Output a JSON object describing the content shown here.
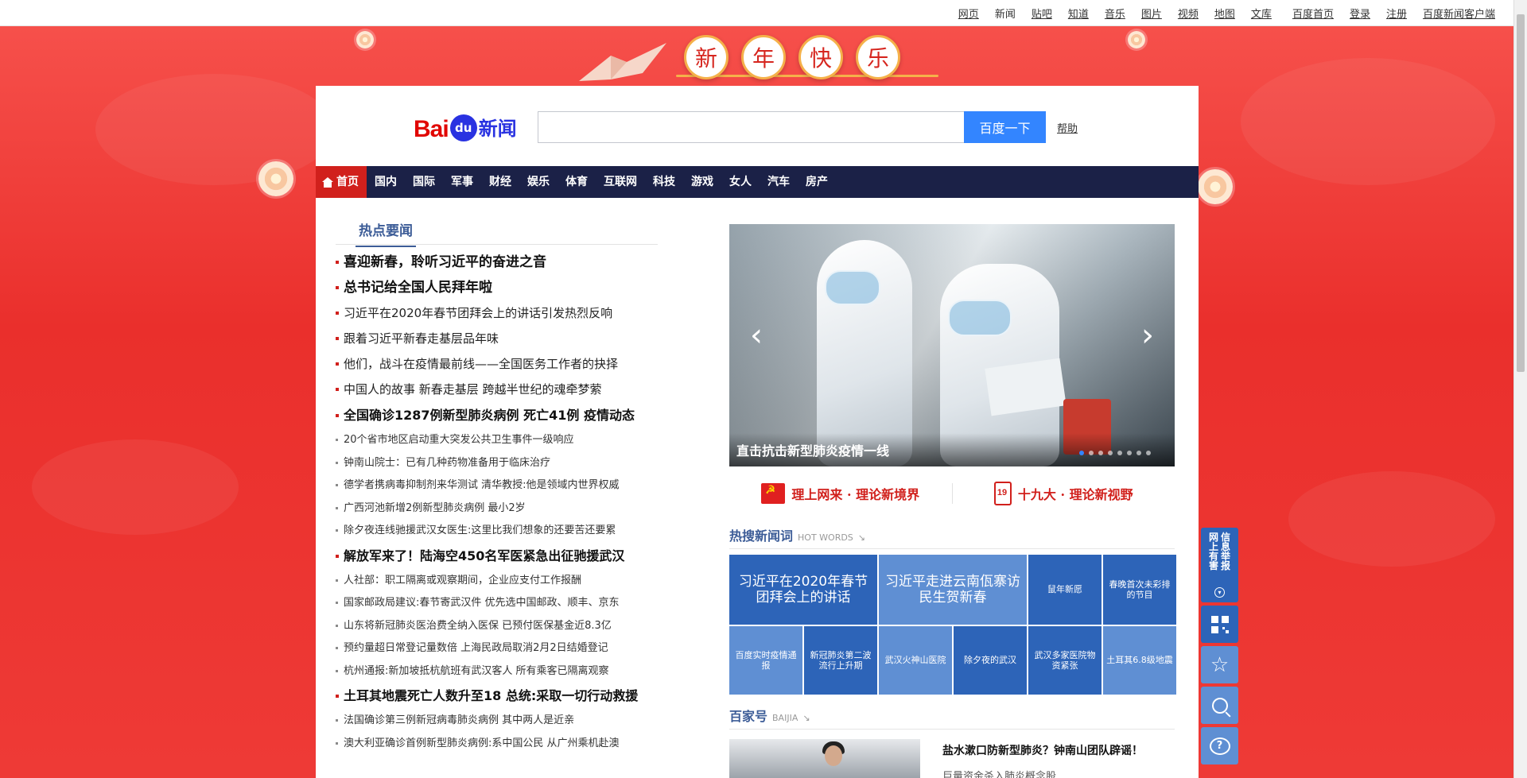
{
  "toplinks": {
    "items": [
      "网页",
      "新闻",
      "贴吧",
      "知道",
      "音乐",
      "图片",
      "视频",
      "地图",
      "文库"
    ],
    "right": [
      "百度首页",
      "登录",
      "注册",
      "百度新闻客户端"
    ]
  },
  "banner": {
    "chars": [
      "新",
      "年",
      "快",
      "乐"
    ]
  },
  "header": {
    "logo_bai": "Bai",
    "logo_du": "du",
    "logo_news": "新闻",
    "search_value": "",
    "search_button": "百度一下",
    "help": "帮助"
  },
  "nav": {
    "items": [
      "首页",
      "国内",
      "国际",
      "军事",
      "财经",
      "娱乐",
      "体育",
      "互联网",
      "科技",
      "游戏",
      "女人",
      "汽车",
      "房产"
    ]
  },
  "hot": {
    "title": "热点要闻",
    "items": [
      {
        "text": "喜迎新春，聆听习近平的奋进之音",
        "style": "big"
      },
      {
        "text": "总书记给全国人民拜年啦",
        "style": "big"
      },
      {
        "text": "习近平在2020年春节团拜会上的讲话引发热烈反响",
        "style": "mid"
      },
      {
        "text": "跟着习近平新春走基层品年味",
        "style": "mid"
      },
      {
        "text": "他们，战斗在疫情最前线——全国医务工作者的抉择",
        "style": "mid"
      },
      {
        "text": "中国人的故事 新春走基层 跨越半世纪的魂牵梦萦",
        "style": "mid"
      },
      {
        "text": "全国确诊1287例新型肺炎病例 死亡41例 疫情动态",
        "style": "head"
      },
      {
        "text": "20个省市地区启动重大突发公共卫生事件一级响应",
        "style": "sm"
      },
      {
        "text": "钟南山院士：已有几种药物准备用于临床治疗",
        "style": "sm"
      },
      {
        "text": "德学者携病毒抑制剂来华测试 清华教授:他是领域内世界权威",
        "style": "sm"
      },
      {
        "text": "广西河池新增2例新型肺炎病例 最小2岁",
        "style": "sm"
      },
      {
        "text": "除夕夜连线驰援武汉女医生:这里比我们想象的还要苦还要累",
        "style": "sm"
      },
      {
        "text": "解放军来了！陆海空450名军医紧急出征驰援武汉",
        "style": "head"
      },
      {
        "text": "人社部：职工隔离或观察期间，企业应支付工作报酬",
        "style": "sm"
      },
      {
        "text": "国家邮政局建议:春节寄武汉件 优先选中国邮政、顺丰、京东",
        "style": "sm"
      },
      {
        "text": "山东将新冠肺炎医治费全纳入医保 已预付医保基金近8.3亿",
        "style": "sm"
      },
      {
        "text": "预约量超日常登记量数倍 上海民政局取消2月2日结婚登记",
        "style": "sm"
      },
      {
        "text": "杭州通报:新加坡抵杭航班有武汉客人 所有乘客已隔离观察",
        "style": "sm"
      },
      {
        "text": "土耳其地震死亡人数升至18 总统:采取一切行动救援",
        "style": "head"
      },
      {
        "text": "法国确诊第三例新冠病毒肺炎病例 其中两人是近亲",
        "style": "sm"
      },
      {
        "text": "澳大利亚确诊首例新型肺炎病例:系中国公民 从广州乘机赴澳",
        "style": "sm"
      }
    ]
  },
  "carousel": {
    "caption": "直击抗击新型肺炎疫情一线",
    "prev": "‹",
    "next": "›",
    "dot_count": 8,
    "active_dot": 0
  },
  "promo": {
    "left": "理上网来 · 理论新境界",
    "right": "十九大 · 理论新视野"
  },
  "hotwords": {
    "title": "热搜新闻词",
    "en": "HOT WORDS",
    "row1": [
      {
        "text": "习近平在2020年春节团拜会上的讲话",
        "shade": "dark",
        "wide": true
      },
      {
        "text": "习近平走进云南佤寨访民生贺新春",
        "shade": "light",
        "wide": true
      },
      {
        "text": "鼠年新愿",
        "shade": "dark",
        "wide": false
      },
      {
        "text": "春晚首次未彩排的节目",
        "shade": "dark",
        "wide": false
      }
    ],
    "row2": [
      {
        "text": "百度实时疫情通报",
        "shade": "light"
      },
      {
        "text": "新冠肺炎第二波流行上升期",
        "shade": "dark"
      },
      {
        "text": "武汉火神山医院",
        "shade": "light"
      },
      {
        "text": "除夕夜的武汉",
        "shade": "dark"
      },
      {
        "text": "武汉多家医院物资紧张",
        "shade": "dark"
      },
      {
        "text": "土耳其6.8级地震",
        "shade": "light"
      }
    ]
  },
  "baijia": {
    "title": "百家号",
    "en": "BAIJIA",
    "headline": "盐水漱口防新型肺炎？钟南山团队辟谣！",
    "sub": "巨量资金杀入肺炎概念股"
  },
  "side": {
    "report_col1": [
      "网",
      "上",
      "有",
      "害"
    ],
    "report_col2": [
      "信",
      "息",
      "举",
      "报"
    ]
  }
}
